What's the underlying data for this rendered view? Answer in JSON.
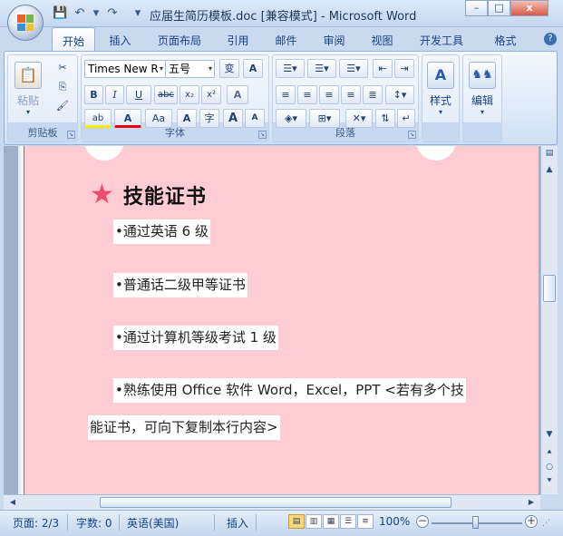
{
  "window": {
    "title": "应届生简历模板.doc [兼容模式] - Microsoft Word",
    "controls": [
      "–",
      "□",
      "x"
    ]
  },
  "quick_access": {
    "save_icon": "💾",
    "undo_icon": "↶",
    "redo_icon": "↷",
    "more_icon": "▾"
  },
  "tabs": [
    "开始",
    "插入",
    "页面布局",
    "引用",
    "邮件",
    "审阅",
    "视图",
    "开发工具",
    "格式"
  ],
  "help_label": "?",
  "ribbon": {
    "clipboard": {
      "label": "剪贴板",
      "paste_label": "粘贴",
      "paste_arrow": "▾",
      "cut": "✂",
      "copy": "⎘",
      "format_painter": "🖌"
    },
    "font": {
      "label": "字体",
      "font_name": "Times New R",
      "font_size": "五号",
      "bold": "B",
      "italic": "I",
      "underline": "U",
      "strike": "abc",
      "subscript": "x₂",
      "superscript": "x²",
      "clear": "A",
      "wen": "变",
      "highlight": "ab",
      "font_color": "A",
      "case": "Aa",
      "char_border": "A",
      "enclose": "字",
      "grow": "A",
      "shrink": "A"
    },
    "paragraph": {
      "label": "段落"
    },
    "styles": {
      "label": "样式"
    },
    "editing": {
      "label": "编辑"
    }
  },
  "document": {
    "heading": "技能证书",
    "star": "★",
    "items": [
      "•通过英语 6 级",
      "•普通话二级甲等证书",
      "•通过计算机等级考试 1 级",
      "•熟练使用 Office 软件 Word，Excel，PPT <若有多个技",
      "能证书，可向下复制本行内容>"
    ]
  },
  "status": {
    "page": "页面: 2/3",
    "words": "字数: 0",
    "language": "英语(美国)",
    "mode": "插入",
    "zoom": "100%",
    "zoom_minus": "−",
    "zoom_plus": "+"
  },
  "colors": {
    "page_bg": "#ffccd3",
    "star": "#ee4a6a",
    "ribbon_text": "#15428b"
  }
}
